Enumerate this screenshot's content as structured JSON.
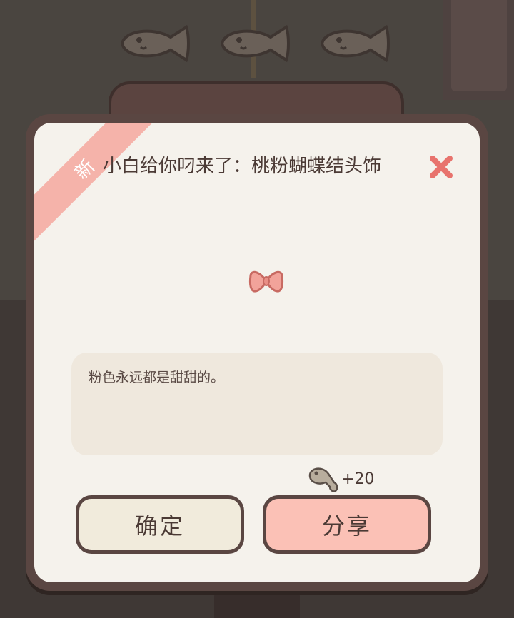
{
  "dialog": {
    "badge": "新",
    "title": "小白给你叼来了：桃粉蝴蝶结头饰",
    "item_icon": "pink-bow-icon",
    "description": "粉色永远都是甜甜的。",
    "reward": {
      "icon": "fish-currency-icon",
      "amount": "+20"
    },
    "buttons": {
      "confirm": "确定",
      "share": "分享"
    },
    "close_icon": "close-icon"
  },
  "background": {
    "fish_counter_icons": [
      "fish-icon",
      "fish-icon",
      "fish-icon"
    ]
  },
  "colors": {
    "ribbon": "#f5b3aa",
    "close": "#e8736d",
    "bow": "#f2a39a",
    "panel": "#f5f2ec",
    "share_button": "#fbc1b6",
    "confirm_button": "#f1ebdc",
    "border": "#5a4642"
  }
}
